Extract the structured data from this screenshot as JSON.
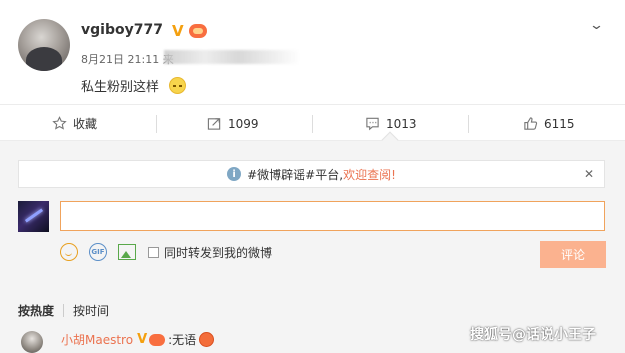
{
  "post": {
    "username": "vgiboy777",
    "verified_mark": "V",
    "timestamp": "8月21日 21:11",
    "source_prefix": "来",
    "text": "私生粉别这样"
  },
  "actions": {
    "favorite_label": "收藏",
    "repost_count": "1099",
    "comment_count": "1013",
    "like_count": "6115"
  },
  "notice": {
    "info_glyph": "i",
    "tag": "#微博辟谣#平台,",
    "link": "欢迎查阅!",
    "close_glyph": "✕"
  },
  "composer": {
    "input_value": "",
    "gif_label": "GIF",
    "share_label": "同时转发到我的微博",
    "submit_label": "评论"
  },
  "sort": {
    "by_hot": "按热度",
    "by_time": "按时间"
  },
  "comments": [
    {
      "user": "小胡Maestro",
      "verified_mark": "V",
      "text": ":无语"
    }
  ],
  "watermark": "搜狐号@话说小王子",
  "colors": {
    "accent_orange": "#eb7350",
    "submit_button": "#fbb28f",
    "input_border": "#f0a35c",
    "verified_gold": "#f4a00f"
  }
}
